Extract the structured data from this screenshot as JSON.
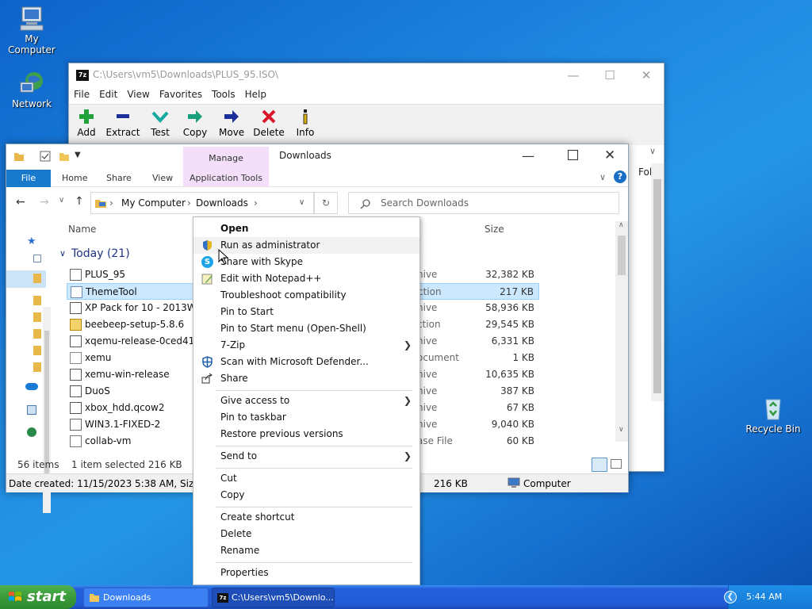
{
  "desktop": {
    "icons": [
      {
        "label": "My Computer"
      },
      {
        "label": "Network"
      },
      {
        "label": "Recycle Bin"
      }
    ]
  },
  "zip": {
    "title": "C:\\Users\\vm5\\Downloads\\PLUS_95.ISO\\",
    "menu": [
      "File",
      "Edit",
      "View",
      "Favorites",
      "Tools",
      "Help"
    ],
    "tools": [
      "Add",
      "Extract",
      "Test",
      "Copy",
      "Move",
      "Delete",
      "Info"
    ],
    "fol": "Fol"
  },
  "explorer": {
    "title": "Downloads",
    "manage": "Manage",
    "tabs": {
      "file": "File",
      "home": "Home",
      "share": "Share",
      "view": "View",
      "app_tools": "Application Tools"
    },
    "breadcrumb": {
      "root": "My Computer",
      "sep": "›",
      "current": "Downloads"
    },
    "search_placeholder": "Search Downloads",
    "columns": {
      "name": "Name",
      "size": "Size"
    },
    "group": "Today (21)",
    "files": [
      {
        "name": "PLUS_95",
        "type": "hive",
        "size": "32,382 KB",
        "icon": "iso-icon"
      },
      {
        "name": "ThemeTool",
        "type": "ction",
        "size": "217 KB",
        "icon": "app-icon"
      },
      {
        "name": "XP Pack for 10 - 2013Wi",
        "type": "hive",
        "size": "58,936 KB",
        "icon": "archive-icon"
      },
      {
        "name": "beebeep-setup-5.8.6",
        "type": "ction",
        "size": "29,545 KB",
        "icon": "setup-icon"
      },
      {
        "name": "xqemu-release-0ced417",
        "type": "hive",
        "size": "6,331 KB",
        "icon": "archive-icon"
      },
      {
        "name": "xemu",
        "type": "ocument",
        "size": "1 KB",
        "icon": "doc-icon"
      },
      {
        "name": "xemu-win-release",
        "type": "hive",
        "size": "10,635 KB",
        "icon": "archive-icon"
      },
      {
        "name": "DuoS",
        "type": "hive",
        "size": "387 KB",
        "icon": "archive-icon"
      },
      {
        "name": "xbox_hdd.qcow2",
        "type": "hive",
        "size": "67 KB",
        "icon": "archive-icon"
      },
      {
        "name": "WIN3.1-FIXED-2",
        "type": "hive",
        "size": "9,040 KB",
        "icon": "iso-icon"
      },
      {
        "name": "collab-vm",
        "type": "ase File",
        "size": "60 KB",
        "icon": "gear-file-icon"
      }
    ],
    "status": {
      "items": "56 items",
      "selected": "1 item selected  216 KB"
    },
    "details": {
      "created": "Date created: 11/15/2023 5:38 AM, Size:",
      "size": "216 KB",
      "location": "Computer"
    }
  },
  "context_menu": {
    "open": "Open",
    "run_admin": "Run as administrator",
    "skype": "Share with Skype",
    "notepad": "Edit with Notepad++",
    "troubleshoot": "Troubleshoot compatibility",
    "pin_start": "Pin to Start",
    "pin_start_menu": "Pin to Start menu (Open-Shell)",
    "sevenzip": "7-Zip",
    "defender": "Scan with Microsoft Defender...",
    "share": "Share",
    "give_access": "Give access to",
    "pin_taskbar": "Pin to taskbar",
    "restore": "Restore previous versions",
    "send_to": "Send to",
    "cut": "Cut",
    "copy": "Copy",
    "create_shortcut": "Create shortcut",
    "delete": "Delete",
    "rename": "Rename",
    "properties": "Properties"
  },
  "taskbar": {
    "start": "start",
    "tasks": [
      {
        "label": "Downloads"
      },
      {
        "label": "C:\\Users\\vm5\\Downlo..."
      }
    ],
    "clock": "5:44 AM"
  }
}
